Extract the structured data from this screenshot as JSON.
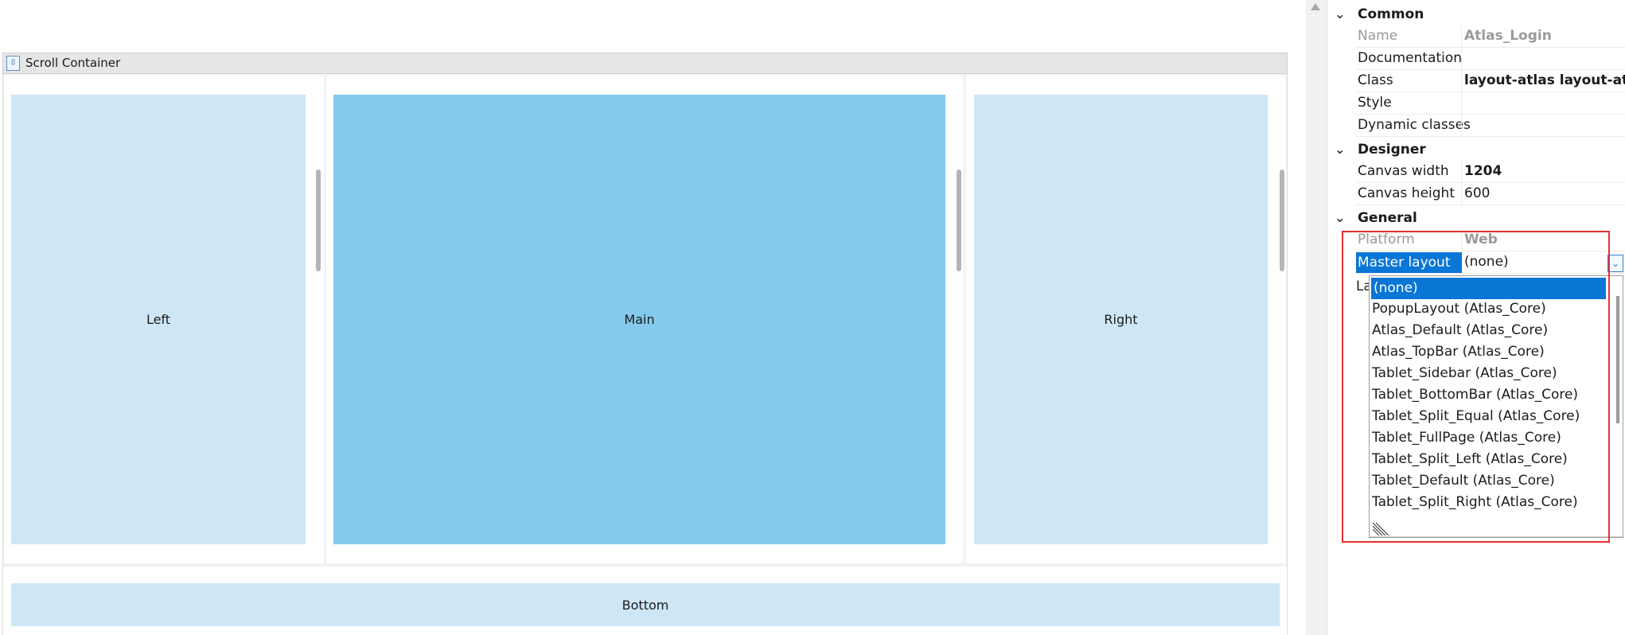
{
  "canvas": {
    "container_label": "Scroll Container",
    "regions": {
      "left": "Left",
      "main": "Main",
      "right": "Right",
      "bottom": "Bottom"
    }
  },
  "properties": {
    "sections": [
      {
        "title": "Common",
        "rows": [
          {
            "key": "Name",
            "value": "Atlas_Login",
            "value_style": "muted-bold"
          },
          {
            "key": "Documentation",
            "value": ""
          },
          {
            "key": "Class",
            "value": "layout-atlas layout-atlas-",
            "value_style": "bold"
          },
          {
            "key": "Style",
            "value": ""
          },
          {
            "key": "Dynamic classes",
            "value": ""
          }
        ]
      },
      {
        "title": "Designer",
        "rows": [
          {
            "key": "Canvas width",
            "value": "1204",
            "value_style": "bold"
          },
          {
            "key": "Canvas height",
            "value": "600"
          }
        ]
      },
      {
        "title": "General",
        "rows": [
          {
            "key": "Platform",
            "value": "Web",
            "key_style": "muted",
            "value_style": "muted-bold"
          },
          {
            "key": "Master layout",
            "value": "(none)",
            "selected": true
          }
        ]
      }
    ],
    "partial_row_key": "La",
    "dropdown": {
      "options": [
        "(none)",
        "PopupLayout (Atlas_Core)",
        "Atlas_Default (Atlas_Core)",
        "Atlas_TopBar (Atlas_Core)",
        "Tablet_Sidebar (Atlas_Core)",
        "Tablet_BottomBar (Atlas_Core)",
        "Tablet_Split_Equal (Atlas_Core)",
        "Tablet_FullPage (Atlas_Core)",
        "Tablet_Split_Left (Atlas_Core)",
        "Tablet_Default (Atlas_Core)",
        "Tablet_Split_Right (Atlas_Core)"
      ],
      "selected_index": 0
    },
    "colors": {
      "selection": "#0a76d6",
      "highlight_box": "#e53030",
      "panel_light": "#cde7f6",
      "panel_main": "#84caec"
    }
  }
}
